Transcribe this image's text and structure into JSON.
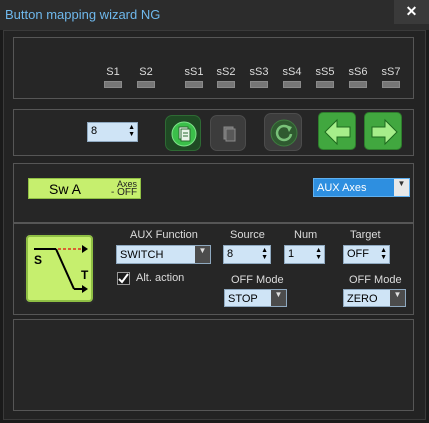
{
  "window": {
    "title": "Button mapping wizard NG",
    "close_label": "✕"
  },
  "slots": [
    "S1",
    "S2",
    "sS1",
    "sS2",
    "sS3",
    "sS4",
    "sS5",
    "sS6",
    "sS7"
  ],
  "toolbar": {
    "number_value": "8"
  },
  "button": {
    "name": "Sw A",
    "mode_line1": "Axes",
    "mode_line2": "- OFF"
  },
  "mode_select": {
    "value": "AUX Axes"
  },
  "aux": {
    "function_label": "AUX Function",
    "function_value": "SWITCH",
    "source_label": "Source",
    "source_value": "8",
    "num_label": "Num",
    "num_value": "1",
    "target_label": "Target",
    "target_value": "OFF",
    "alt_action_label": "Alt. action",
    "alt_action_checked": true,
    "off_mode_label_1": "OFF Mode",
    "off_mode_value_1": "STOP",
    "off_mode_label_2": "OFF Mode",
    "off_mode_value_2": "ZERO"
  },
  "icon_letters": {
    "s": "S",
    "t": "T"
  },
  "colors": {
    "accent_green": "#41a73f",
    "switch_bg": "#c6ef6e",
    "title_blue": "#6fb8ec",
    "field_bg": "#cfe4f6"
  }
}
